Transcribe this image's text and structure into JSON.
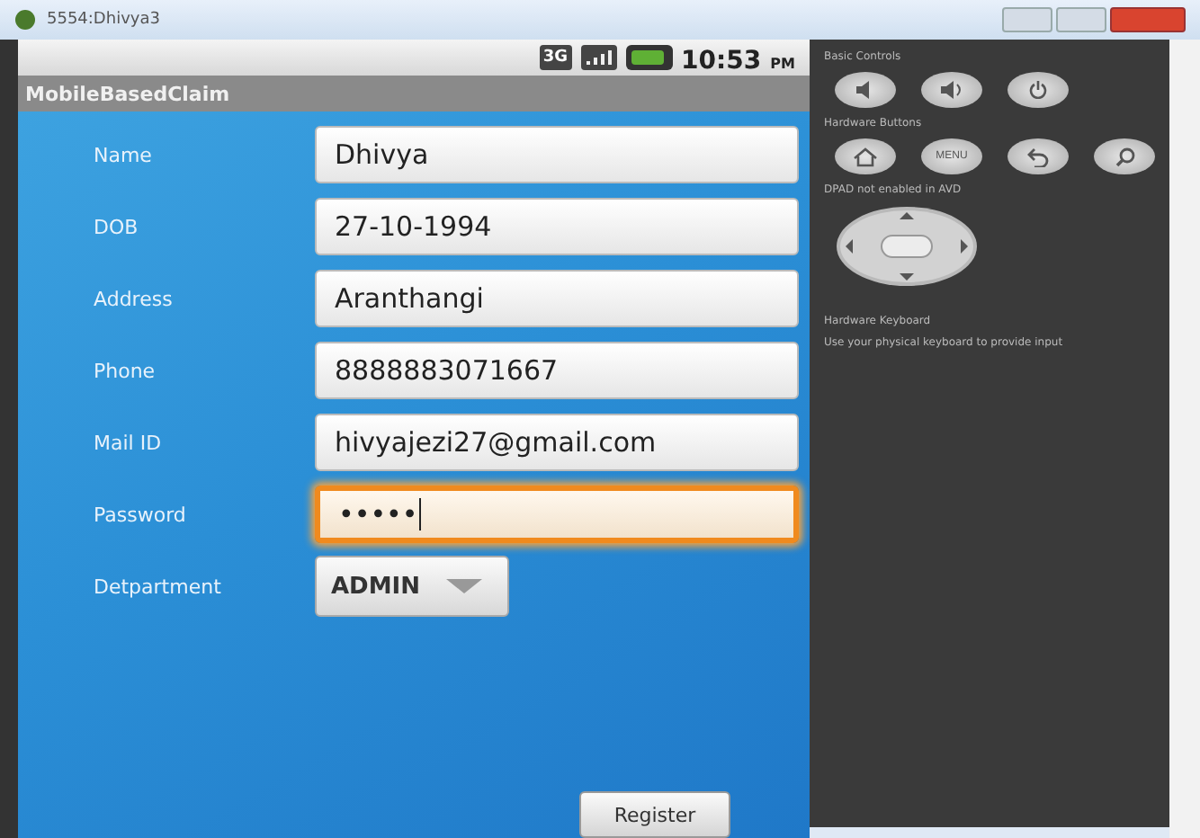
{
  "window": {
    "title": "5554:Dhivya3"
  },
  "status_bar": {
    "network": "3G",
    "time": "10:53",
    "ampm": "PM"
  },
  "app_bar": {
    "title": "MobileBasedClaim"
  },
  "form": {
    "fields": [
      {
        "label": "Name",
        "value": "Dhivya",
        "kind": "text",
        "focused": false
      },
      {
        "label": "DOB",
        "value": "27-10-1994",
        "kind": "text",
        "focused": false
      },
      {
        "label": "Address",
        "value": "Aranthangi",
        "kind": "text",
        "focused": false
      },
      {
        "label": "Phone",
        "value": "8888883071667",
        "kind": "text",
        "focused": false
      },
      {
        "label": "Mail ID",
        "value": "hivyajezi27@gmail.com",
        "kind": "text",
        "focused": false
      },
      {
        "label": "Password",
        "value": "•••••",
        "kind": "password",
        "focused": true
      },
      {
        "label": "Detpartment",
        "value": "ADMIN",
        "kind": "spinner",
        "focused": false
      }
    ]
  },
  "register_button": "Register",
  "controls": {
    "sections": [
      {
        "title": "Basic Controls",
        "kind": "buttons",
        "buttons": [
          {
            "kind": "volume-down"
          },
          {
            "kind": "volume-up"
          },
          {
            "kind": "power"
          }
        ]
      },
      {
        "title": "Hardware Buttons",
        "kind": "buttons",
        "buttons": [
          {
            "kind": "home"
          },
          {
            "kind": "menu",
            "label": "MENU"
          },
          {
            "kind": "back"
          },
          {
            "kind": "search"
          }
        ]
      },
      {
        "title": "DPAD not enabled in AVD",
        "kind": "dpad"
      },
      {
        "title": "Hardware Keyboard",
        "kind": "note",
        "note": "Use your physical keyboard to provide input"
      }
    ]
  }
}
